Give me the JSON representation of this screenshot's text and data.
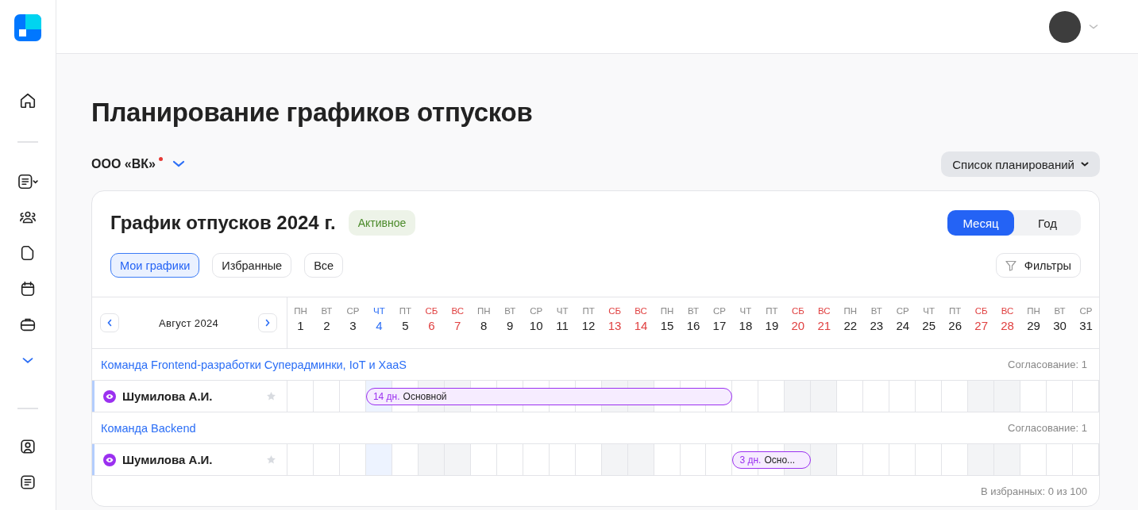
{
  "page_title": "Планирование графиков отпусков",
  "organization": {
    "name": "ООО «ВК»",
    "has_notification": true
  },
  "plans_button": "Список планирований",
  "schedule": {
    "title": "График отпусков 2024 г.",
    "status": "Активное",
    "view_modes": [
      {
        "label": "Месяц",
        "selected": true
      },
      {
        "label": "Год",
        "selected": false
      }
    ],
    "filter_chips": [
      {
        "label": "Мои графики",
        "selected": true
      },
      {
        "label": "Избранные",
        "selected": false
      },
      {
        "label": "Все",
        "selected": false
      }
    ],
    "filters_button": "Фильтры",
    "month": "Август 2024",
    "days": [
      {
        "weekday": "ПН",
        "day": "1",
        "kind": "workday"
      },
      {
        "weekday": "ВТ",
        "day": "2",
        "kind": "workday"
      },
      {
        "weekday": "СР",
        "day": "3",
        "kind": "workday"
      },
      {
        "weekday": "ЧТ",
        "day": "4",
        "kind": "today"
      },
      {
        "weekday": "ПТ",
        "day": "5",
        "kind": "workday"
      },
      {
        "weekday": "СБ",
        "day": "6",
        "kind": "weekend"
      },
      {
        "weekday": "ВС",
        "day": "7",
        "kind": "weekend"
      },
      {
        "weekday": "ПН",
        "day": "8",
        "kind": "workday"
      },
      {
        "weekday": "ВТ",
        "day": "9",
        "kind": "workday"
      },
      {
        "weekday": "СР",
        "day": "10",
        "kind": "workday"
      },
      {
        "weekday": "ЧТ",
        "day": "11",
        "kind": "workday"
      },
      {
        "weekday": "ПТ",
        "day": "12",
        "kind": "workday"
      },
      {
        "weekday": "СБ",
        "day": "13",
        "kind": "weekend"
      },
      {
        "weekday": "ВС",
        "day": "14",
        "kind": "weekend"
      },
      {
        "weekday": "ПН",
        "day": "15",
        "kind": "workday"
      },
      {
        "weekday": "ВТ",
        "day": "16",
        "kind": "workday"
      },
      {
        "weekday": "СР",
        "day": "17",
        "kind": "workday"
      },
      {
        "weekday": "ЧТ",
        "day": "18",
        "kind": "workday"
      },
      {
        "weekday": "ПТ",
        "day": "19",
        "kind": "workday"
      },
      {
        "weekday": "СБ",
        "day": "20",
        "kind": "weekend"
      },
      {
        "weekday": "ВС",
        "day": "21",
        "kind": "weekend"
      },
      {
        "weekday": "ПН",
        "day": "22",
        "kind": "workday"
      },
      {
        "weekday": "ВТ",
        "day": "23",
        "kind": "workday"
      },
      {
        "weekday": "СР",
        "day": "24",
        "kind": "workday"
      },
      {
        "weekday": "ЧТ",
        "day": "25",
        "kind": "workday"
      },
      {
        "weekday": "ПТ",
        "day": "26",
        "kind": "workday"
      },
      {
        "weekday": "СБ",
        "day": "27",
        "kind": "weekend"
      },
      {
        "weekday": "ВС",
        "day": "28",
        "kind": "weekend"
      },
      {
        "weekday": "ПН",
        "day": "29",
        "kind": "workday"
      },
      {
        "weekday": "ВТ",
        "day": "30",
        "kind": "workday"
      },
      {
        "weekday": "СР",
        "day": "31",
        "kind": "workday"
      }
    ],
    "teams": [
      {
        "name": "Команда Frontend-разработки Суперадминки, IoT и XaaS",
        "approval": "Согласование: 1",
        "employees": [
          {
            "name": "Шумилова А.И.",
            "favorite": false,
            "booked_days": [
              false,
              false,
              false,
              true,
              true,
              true,
              true,
              true,
              true,
              true,
              true,
              true,
              true,
              true,
              true,
              true,
              true,
              false,
              false,
              false,
              false,
              false,
              false,
              false,
              false,
              false,
              false,
              false,
              false,
              false,
              false
            ],
            "vacations": [
              {
                "duration": "14 дн.",
                "type": "Основной"
              }
            ]
          }
        ]
      },
      {
        "name": "Команда Backend",
        "approval": "Согласование: 1",
        "employees": [
          {
            "name": "Шумилова А.И.",
            "favorite": false,
            "booked_days": [
              false,
              false,
              false,
              false,
              false,
              false,
              false,
              false,
              false,
              false,
              false,
              false,
              false,
              false,
              false,
              false,
              false,
              true,
              true,
              true,
              false,
              false,
              false,
              false,
              false,
              false,
              false,
              false,
              false,
              false,
              false
            ],
            "vacations": [
              {
                "duration": "3 дн.",
                "type": "Осно..."
              }
            ]
          }
        ]
      }
    ],
    "favorites_count": "В избранных: 0 из 100"
  }
}
